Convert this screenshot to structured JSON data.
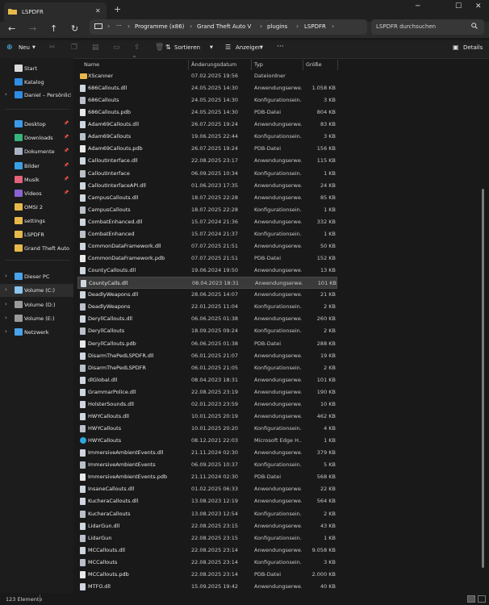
{
  "window": {
    "tab_title": "LSPDFR",
    "tab_close": "✕",
    "new_tab": "+",
    "minimize": "─",
    "maximize": "☐",
    "close": "✕"
  },
  "nav": {
    "back": "←",
    "forward": "→",
    "up": "↑",
    "refresh": "↻",
    "more": "···",
    "breadcrumbs": [
      "Programme (x86)",
      "Grand Theft Auto V",
      "plugins",
      "LSPDFR"
    ],
    "separator": "›"
  },
  "search": {
    "placeholder": "LSPDFR durchsuchen",
    "icon": "search-icon"
  },
  "commandbar": {
    "new_label": "Neu",
    "sort_label": "Sortieren",
    "view_label": "Anzeigen",
    "more_label": "···",
    "details_label": "Details"
  },
  "sidebar": {
    "items": [
      {
        "label": "Start",
        "icon": "home-icon",
        "color": "#dcdcdc",
        "pinned": false,
        "chevron": false
      },
      {
        "label": "Katalog",
        "icon": "gallery-icon",
        "color": "#2f8de4",
        "pinned": false,
        "chevron": false
      },
      {
        "label": "Daniel – Persönlich",
        "icon": "onedrive-icon",
        "color": "#2f8de4",
        "pinned": false,
        "chevron": true
      },
      {
        "label": "Desktop",
        "icon": "desktop-icon",
        "color": "#3b9ae8",
        "pinned": true,
        "chevron": false
      },
      {
        "label": "Downloads",
        "icon": "download-icon",
        "color": "#37b37e",
        "pinned": true,
        "chevron": false
      },
      {
        "label": "Dokumente",
        "icon": "documents-icon",
        "color": "#a7b4c4",
        "pinned": true,
        "chevron": false
      },
      {
        "label": "Bilder",
        "icon": "pictures-icon",
        "color": "#3aa0e6",
        "pinned": true,
        "chevron": false
      },
      {
        "label": "Musik",
        "icon": "music-icon",
        "color": "#e2637a",
        "pinned": true,
        "chevron": false
      },
      {
        "label": "Videos",
        "icon": "videos-icon",
        "color": "#8a63d2",
        "pinned": true,
        "chevron": false
      },
      {
        "label": "OMSI 2",
        "icon": "folder-icon",
        "color": "#e8b94a",
        "pinned": false,
        "chevron": false
      },
      {
        "label": "settings",
        "icon": "folder-icon",
        "color": "#e8b94a",
        "pinned": false,
        "chevron": false
      },
      {
        "label": "LSPDFR",
        "icon": "folder-icon",
        "color": "#e8b94a",
        "pinned": false,
        "chevron": false
      },
      {
        "label": "Grand Theft Auto V",
        "icon": "folder-icon",
        "color": "#e8b94a",
        "pinned": false,
        "chevron": false
      },
      {
        "label": "Dieser PC",
        "icon": "computer-icon",
        "color": "#4aa3e8",
        "pinned": false,
        "chevron": true
      },
      {
        "label": "Volume (C:)",
        "icon": "drive-icon",
        "color": "#8bc4ee",
        "pinned": false,
        "chevron": true
      },
      {
        "label": "Volume (D:)",
        "icon": "drive-icon",
        "color": "#9a9a9a",
        "pinned": false,
        "chevron": true
      },
      {
        "label": "Volume (E:)",
        "icon": "drive-icon",
        "color": "#9a9a9a",
        "pinned": false,
        "chevron": true
      },
      {
        "label": "Netzwerk",
        "icon": "network-icon",
        "color": "#4aa3e8",
        "pinned": false,
        "chevron": true
      }
    ]
  },
  "columns": {
    "name": "Name",
    "date": "Änderungsdatum",
    "type": "Typ",
    "size": "Größe"
  },
  "files": [
    {
      "name": "XScanner",
      "date": "07.02.2025 19:56",
      "type": "Dateiordner",
      "size": "",
      "kind": "folder"
    },
    {
      "name": "686Callouts.dll",
      "date": "24.05.2025 14:30",
      "type": "Anwendungserwe...",
      "size": "1.058 KB",
      "kind": "dll"
    },
    {
      "name": "686Callouts",
      "date": "24.05.2025 14:30",
      "type": "Konfigurationsein...",
      "size": "3 KB",
      "kind": "ini"
    },
    {
      "name": "686Callouts.pdb",
      "date": "24.05.2025 14:30",
      "type": "PDB-Datei",
      "size": "804 KB",
      "kind": "pdb"
    },
    {
      "name": "Adam69Callouts.dll",
      "date": "26.07.2025 19:24",
      "type": "Anwendungserwe...",
      "size": "83 KB",
      "kind": "dll"
    },
    {
      "name": "Adam69Callouts",
      "date": "19.06.2025 22:44",
      "type": "Konfigurationsein...",
      "size": "3 KB",
      "kind": "ini"
    },
    {
      "name": "Adam69Callouts.pdb",
      "date": "26.07.2025 19:24",
      "type": "PDB-Datei",
      "size": "156 KB",
      "kind": "pdb"
    },
    {
      "name": "CalloutInterface.dll",
      "date": "22.08.2025 23:17",
      "type": "Anwendungserwe...",
      "size": "115 KB",
      "kind": "dll"
    },
    {
      "name": "CalloutInterface",
      "date": "06.09.2025 10:34",
      "type": "Konfigurationsein...",
      "size": "1 KB",
      "kind": "ini"
    },
    {
      "name": "CalloutInterfaceAPI.dll",
      "date": "01.06.2023 17:35",
      "type": "Anwendungserwe...",
      "size": "24 KB",
      "kind": "dll"
    },
    {
      "name": "CampusCallouts.dll",
      "date": "18.07.2025 22:28",
      "type": "Anwendungserwe...",
      "size": "85 KB",
      "kind": "dll"
    },
    {
      "name": "CampusCallouts",
      "date": "18.07.2025 22:28",
      "type": "Konfigurationsein...",
      "size": "1 KB",
      "kind": "ini"
    },
    {
      "name": "CombatEnhanced.dll",
      "date": "15.07.2024 21:36",
      "type": "Anwendungserwe...",
      "size": "332 KB",
      "kind": "dll"
    },
    {
      "name": "CombatEnhanced",
      "date": "15.07.2024 21:37",
      "type": "Konfigurationsein...",
      "size": "1 KB",
      "kind": "ini"
    },
    {
      "name": "CommonDataFramework.dll",
      "date": "07.07.2025 21:51",
      "type": "Anwendungserwe...",
      "size": "50 KB",
      "kind": "dll"
    },
    {
      "name": "CommonDataFramework.pdb",
      "date": "07.07.2025 21:51",
      "type": "PDB-Datei",
      "size": "152 KB",
      "kind": "pdb"
    },
    {
      "name": "CountyCallouts.dll",
      "date": "19.06.2024 19:50",
      "type": "Anwendungserwe...",
      "size": "13 KB",
      "kind": "dll"
    },
    {
      "name": "CountyCalls.dll",
      "date": "08.04.2023 18:31",
      "type": "Anwendungserwe...",
      "size": "101 KB",
      "kind": "dll",
      "selected": true
    },
    {
      "name": "DeadlyWeapons.dll",
      "date": "28.06.2025 14:07",
      "type": "Anwendungserwe...",
      "size": "21 KB",
      "kind": "dll"
    },
    {
      "name": "DeadlyWeapons",
      "date": "22.01.2025 11:04",
      "type": "Konfigurationsein...",
      "size": "2 KB",
      "kind": "ini"
    },
    {
      "name": "DeryllCallouts.dll",
      "date": "06.06.2025 01:38",
      "type": "Anwendungserwe...",
      "size": "260 KB",
      "kind": "dll"
    },
    {
      "name": "DeryllCallouts",
      "date": "18.09.2025 09:24",
      "type": "Konfigurationsein...",
      "size": "2 KB",
      "kind": "ini"
    },
    {
      "name": "DeryllCallouts.pdb",
      "date": "06.06.2025 01:38",
      "type": "PDB-Datei",
      "size": "288 KB",
      "kind": "pdb"
    },
    {
      "name": "DisarmThePedLSPDFR.dll",
      "date": "06.01.2025 21:07",
      "type": "Anwendungserwe...",
      "size": "19 KB",
      "kind": "dll"
    },
    {
      "name": "DisarmThePedLSPDFR",
      "date": "06.01.2025 21:05",
      "type": "Konfigurationsein...",
      "size": "2 KB",
      "kind": "ini"
    },
    {
      "name": "dlGlobal.dll",
      "date": "08.04.2023 18:31",
      "type": "Anwendungserwe...",
      "size": "101 KB",
      "kind": "dll"
    },
    {
      "name": "GrammarPolice.dll",
      "date": "22.08.2025 23:19",
      "type": "Anwendungserwe...",
      "size": "190 KB",
      "kind": "dll"
    },
    {
      "name": "HolsterSounds.dll",
      "date": "02.01.2023 23:59",
      "type": "Anwendungserwe...",
      "size": "10 KB",
      "kind": "dll"
    },
    {
      "name": "HWYCallouts.dll",
      "date": "10.01.2025 20:19",
      "type": "Anwendungserwe...",
      "size": "462 KB",
      "kind": "dll"
    },
    {
      "name": "HWYCallouts",
      "date": "10.01.2025 20:20",
      "type": "Konfigurationsein...",
      "size": "4 KB",
      "kind": "ini"
    },
    {
      "name": "HWYCallouts",
      "date": "08.12.2021 22:03",
      "type": "Microsoft Edge H...",
      "size": "1 KB",
      "kind": "edge"
    },
    {
      "name": "ImmersiveAmbientEvents.dll",
      "date": "21.11.2024 02:30",
      "type": "Anwendungserwe...",
      "size": "379 KB",
      "kind": "dll"
    },
    {
      "name": "ImmersiveAmbientEvents",
      "date": "06.09.2025 10:37",
      "type": "Konfigurationsein...",
      "size": "5 KB",
      "kind": "ini"
    },
    {
      "name": "ImmersiveAmbientEvents.pdb",
      "date": "21.11.2024 02:30",
      "type": "PDB-Datei",
      "size": "568 KB",
      "kind": "pdb"
    },
    {
      "name": "InsaneCallouts.dll",
      "date": "01.02.2025 06:33",
      "type": "Anwendungserwe...",
      "size": "22 KB",
      "kind": "dll"
    },
    {
      "name": "KucheraCallouts.dll",
      "date": "13.08.2023 12:19",
      "type": "Anwendungserwe...",
      "size": "564 KB",
      "kind": "dll"
    },
    {
      "name": "KucheraCallouts",
      "date": "13.08.2023 12:54",
      "type": "Konfigurationsein...",
      "size": "2 KB",
      "kind": "ini"
    },
    {
      "name": "LidarGun.dll",
      "date": "22.08.2025 23:15",
      "type": "Anwendungserwe...",
      "size": "43 KB",
      "kind": "dll"
    },
    {
      "name": "LidarGun",
      "date": "22.08.2025 23:15",
      "type": "Konfigurationsein...",
      "size": "1 KB",
      "kind": "ini"
    },
    {
      "name": "MCCallouts.dll",
      "date": "22.08.2025 23:14",
      "type": "Anwendungserwe...",
      "size": "9.058 KB",
      "kind": "dll"
    },
    {
      "name": "MCCallouts",
      "date": "22.08.2025 23:14",
      "type": "Konfigurationsein...",
      "size": "3 KB",
      "kind": "ini"
    },
    {
      "name": "MCCallouts.pdb",
      "date": "22.08.2025 23:14",
      "type": "PDB-Datei",
      "size": "2.000 KB",
      "kind": "pdb"
    },
    {
      "name": "MTFO.dll",
      "date": "15.09.2025 19:42",
      "type": "Anwendungserwe...",
      "size": "40 KB",
      "kind": "dll"
    }
  ],
  "status": {
    "item_count": "123 Elemente"
  },
  "colors": {
    "folder": "#e8b94a",
    "dll": "#cfd6de",
    "ini": "#b9c0c8",
    "pdb": "#e9e9e9",
    "edge": "#2fa6de",
    "accent": "#4cc2ff"
  }
}
